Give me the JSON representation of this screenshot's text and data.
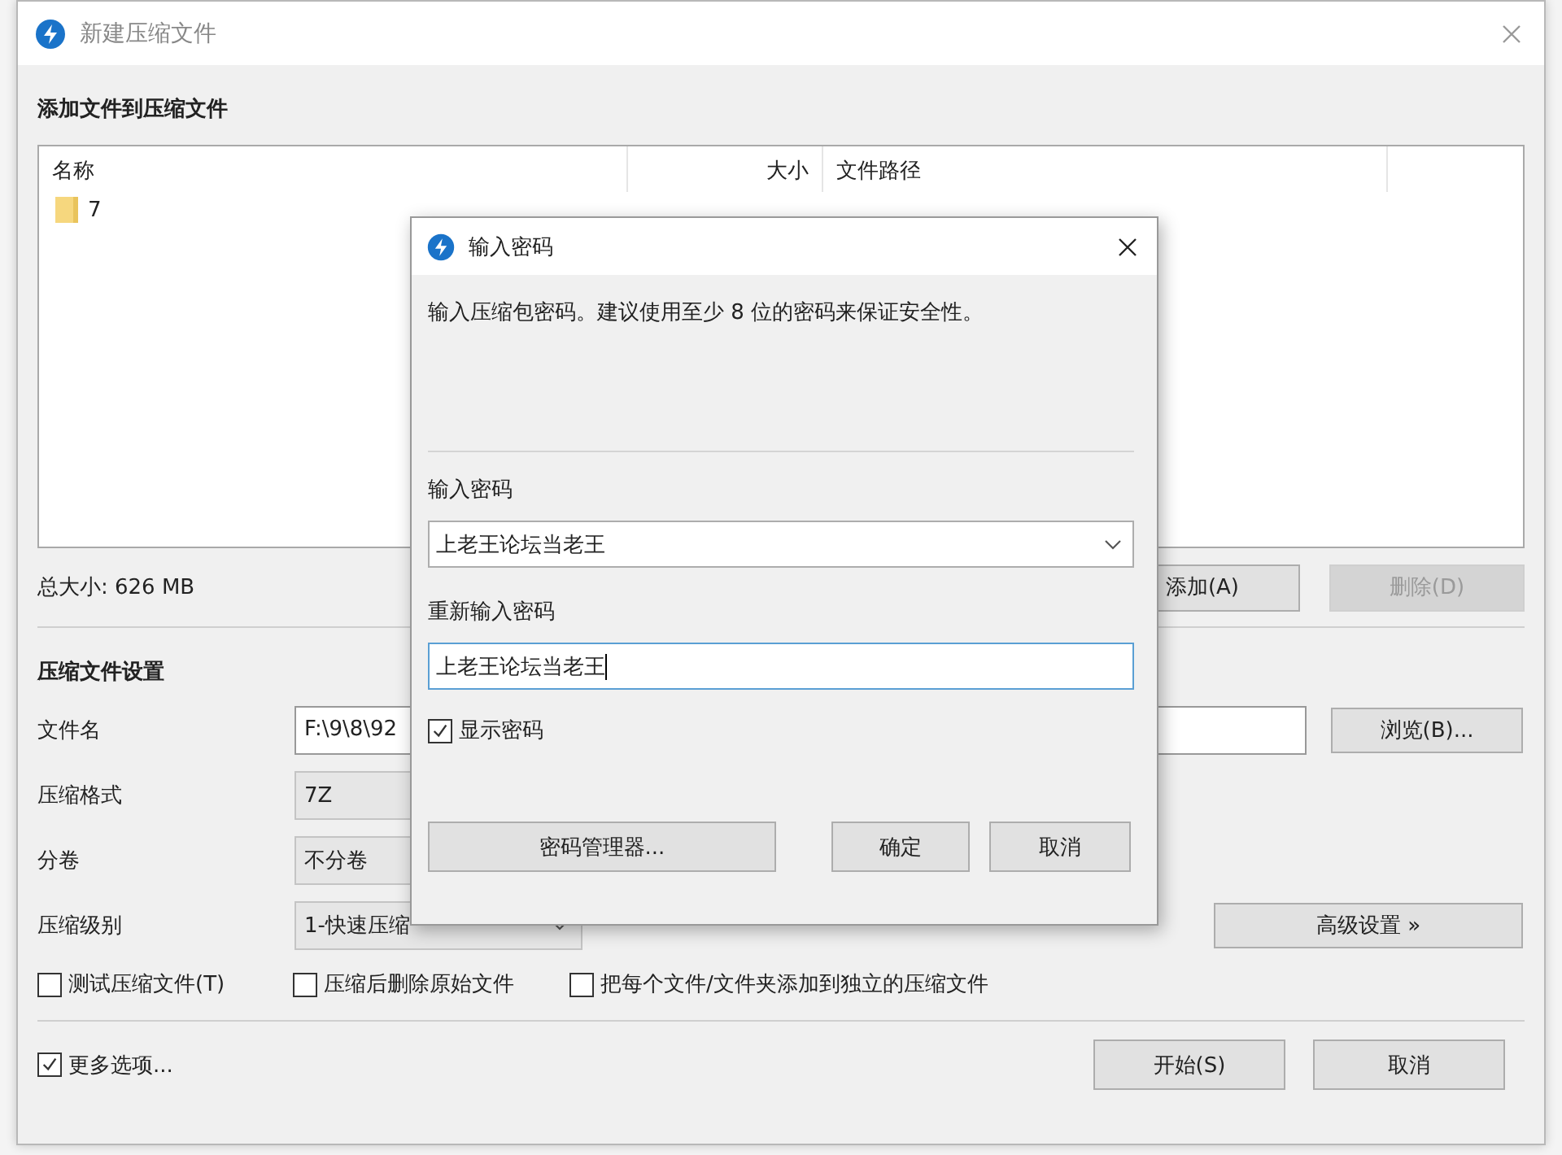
{
  "window": {
    "title": "新建压缩文件"
  },
  "files": {
    "heading": "添加文件到压缩文件",
    "columns": [
      "名称",
      "大小",
      "文件路径"
    ],
    "rows": [
      {
        "name": "7",
        "kind": "folder"
      }
    ],
    "total": "总大小: 626 MB",
    "buttons": [
      {
        "label": "添加(A)",
        "disabled": false
      },
      {
        "label": "删除(D)",
        "disabled": true
      }
    ]
  },
  "settings": {
    "heading": "压缩文件设置",
    "fields": [
      {
        "label": "文件名",
        "kind": "text",
        "value": "F:\\9\\8\\92"
      },
      {
        "label": "压缩格式",
        "kind": "dropdown",
        "value": "7Z"
      },
      {
        "label": "分卷",
        "kind": "dropdown",
        "value": "不分卷"
      },
      {
        "label": "压缩级别",
        "kind": "dropdown",
        "value": "1-快速压缩"
      }
    ],
    "browse_button": "浏览(B)...",
    "advanced_button": "高级设置 »",
    "options": [
      {
        "label": "测试压缩文件(T)",
        "checked": false
      },
      {
        "label": "压缩后删除原始文件",
        "checked": false
      },
      {
        "label": "把每个文件/文件夹添加到独立的压缩文件",
        "checked": false
      }
    ]
  },
  "more_options": {
    "label": "更多选项...",
    "checked": true
  },
  "buttons": [
    "开始(S)",
    "取消"
  ],
  "dialog": {
    "title": "输入密码",
    "description": "输入压缩包密码。建议使用至少 8 位的密码来保证安全性。",
    "password": {
      "label": "输入密码",
      "value": "上老王论坛当老王"
    },
    "confirm": {
      "label": "重新输入密码",
      "value": "上老王论坛当老王",
      "focused": true
    },
    "show_password": {
      "label": "显示密码",
      "checked": true
    },
    "buttons": [
      "密码管理器...",
      "确定",
      "取消"
    ]
  }
}
